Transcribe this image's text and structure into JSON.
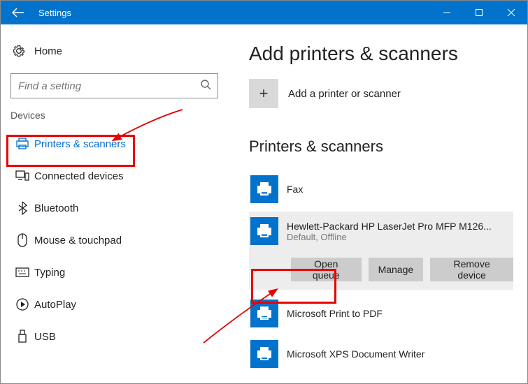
{
  "titlebar": {
    "title": "Settings"
  },
  "sidebar": {
    "home_label": "Home",
    "search_placeholder": "Find a setting",
    "section_label": "Devices",
    "items": [
      {
        "label": "Printers & scanners",
        "active": true
      },
      {
        "label": "Connected devices"
      },
      {
        "label": "Bluetooth"
      },
      {
        "label": "Mouse & touchpad"
      },
      {
        "label": "Typing"
      },
      {
        "label": "AutoPlay"
      },
      {
        "label": "USB"
      }
    ]
  },
  "main": {
    "add_heading": "Add printers & scanners",
    "add_label": "Add a printer or scanner",
    "list_heading": "Printers & scanners",
    "devices": [
      {
        "name": "Fax",
        "sub": ""
      },
      {
        "name": "Hewlett-Packard HP LaserJet Pro MFP M126...",
        "sub": "Default, Offline",
        "selected": true
      },
      {
        "name": "Microsoft Print to PDF",
        "sub": ""
      },
      {
        "name": "Microsoft XPS Document Writer",
        "sub": ""
      }
    ],
    "actions": {
      "open_queue": "Open queue",
      "manage": "Manage",
      "remove": "Remove device"
    }
  }
}
